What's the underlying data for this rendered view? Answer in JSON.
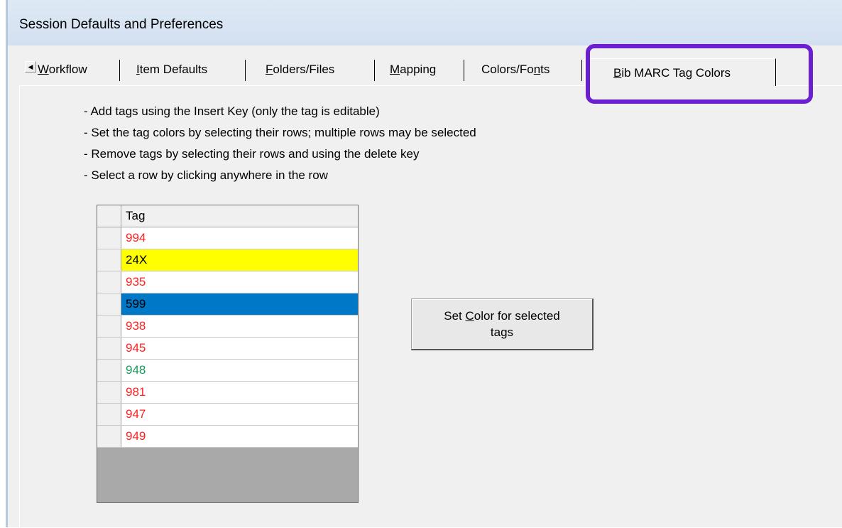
{
  "window": {
    "title": "Session Defaults and Preferences"
  },
  "tabs": [
    {
      "label": "Workflow",
      "mnemonic": "W",
      "rest": "orkflow"
    },
    {
      "label": "Item Defaults",
      "mnemonic": "I",
      "rest": "tem Defaults"
    },
    {
      "label": "Folders/Files",
      "mnemonic": "F",
      "rest": "olders/Files"
    },
    {
      "label": "Mapping",
      "mnemonic": "M",
      "rest": "apping"
    },
    {
      "label": "Colors/Fonts",
      "pre": "Colors/Fo",
      "mnemonic": "n",
      "rest": "ts"
    },
    {
      "label": "Bib MARC Tag Colors",
      "mnemonic": "B",
      "rest": "ib MARC Tag Colors",
      "active": true
    }
  ],
  "instructions": [
    "- Add tags using the Insert Key (only the tag is editable)",
    "- Set the tag colors by selecting their rows; multiple rows may be selected",
    "- Remove tags by selecting their rows and using the delete key",
    "- Select a row by clicking anywhere in the row"
  ],
  "grid": {
    "header": "Tag",
    "rows": [
      {
        "tag": "994",
        "color": "#ff2020",
        "bg": "#ffffff"
      },
      {
        "tag": "24X",
        "color": "#000000",
        "bg": "#ffff00"
      },
      {
        "tag": "935",
        "color": "#ff2020",
        "bg": "#ffffff"
      },
      {
        "tag": "599",
        "color": "#000000",
        "bg": "#0078c8"
      },
      {
        "tag": "938",
        "color": "#ff2020",
        "bg": "#ffffff"
      },
      {
        "tag": "945",
        "color": "#ff2020",
        "bg": "#ffffff"
      },
      {
        "tag": "948",
        "color": "#1a9a5a",
        "bg": "#ffffff"
      },
      {
        "tag": "981",
        "color": "#ff2020",
        "bg": "#ffffff"
      },
      {
        "tag": "947",
        "color": "#ff2020",
        "bg": "#ffffff"
      },
      {
        "tag": "949",
        "color": "#ff2020",
        "bg": "#ffffff"
      }
    ]
  },
  "set_color_button": {
    "pre": "Set ",
    "mnemonic": "C",
    "rest": "olor for selected",
    "line2": "tags"
  },
  "colors": {
    "highlight": "#6b1fd0",
    "selected_row": "#0078c8"
  }
}
